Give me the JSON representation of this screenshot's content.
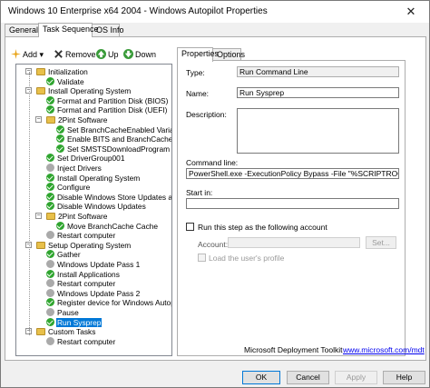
{
  "window": {
    "title": "Windows 10 Enterprise x64 2004 - Windows Autopilot Properties",
    "close": "✕"
  },
  "tabs": [
    {
      "label": "General"
    },
    {
      "label": "Task Sequence"
    },
    {
      "label": "OS Info"
    }
  ],
  "toolbar": {
    "add": "Add",
    "remove": "Remove",
    "up": "Up",
    "down": "Down",
    "chevron": "▾"
  },
  "tree": [
    {
      "label": "Initialization",
      "icon": "folder-icon"
    },
    {
      "label": "Validate",
      "icon": "check-icon"
    },
    {
      "label": "Install Operating System",
      "icon": "folder-icon"
    },
    {
      "label": "Format and Partition Disk (BIOS)",
      "icon": "check-icon"
    },
    {
      "label": "Format and Partition Disk (UEFI)",
      "icon": "check-icon"
    },
    {
      "label": "2Pint Software",
      "icon": "folder-icon"
    },
    {
      "label": "Set BranchCacheEnabled Variable",
      "icon": "check-icon"
    },
    {
      "label": "Enable BITS and BranchCache",
      "icon": "check-icon"
    },
    {
      "label": "Set SMSTSDownloadProgram Variab",
      "icon": "check-icon"
    },
    {
      "label": "Set DriverGroup001",
      "icon": "check-icon"
    },
    {
      "label": "Inject Drivers",
      "icon": "gray-icon"
    },
    {
      "label": "Install Operating System",
      "icon": "check-icon"
    },
    {
      "label": "Configure",
      "icon": "check-icon"
    },
    {
      "label": "Disable Windows Store Updates and Con",
      "icon": "check-icon"
    },
    {
      "label": "Disable Windows Updates",
      "icon": "check-icon"
    },
    {
      "label": "2Pint Software",
      "icon": "folder-icon"
    },
    {
      "label": "Move BranchCache Cache",
      "icon": "check-icon"
    },
    {
      "label": "Restart computer",
      "icon": "gray-icon"
    },
    {
      "label": "Setup Operating System",
      "icon": "folder-icon"
    },
    {
      "label": "Gather",
      "icon": "check-icon"
    },
    {
      "label": "Windows Update Pass 1",
      "icon": "gray-icon"
    },
    {
      "label": "Install Applications",
      "icon": "check-icon"
    },
    {
      "label": "Restart computer",
      "icon": "gray-icon"
    },
    {
      "label": "Windows Update Pass 2",
      "icon": "gray-icon"
    },
    {
      "label": "Register device for Windows Autopilot (Pr",
      "icon": "check-icon"
    },
    {
      "label": "Pause",
      "icon": "gray-icon"
    },
    {
      "label": "Run Sysprep",
      "icon": "check-icon"
    },
    {
      "label": "Custom Tasks",
      "icon": "folder-icon"
    },
    {
      "label": "Restart computer",
      "icon": "gray-icon"
    }
  ],
  "right_tabs": [
    {
      "label": "Properties"
    },
    {
      "label": "Options"
    }
  ],
  "props": {
    "type_label": "Type:",
    "type_value": "Run Command Line",
    "name_label": "Name:",
    "name_value": "Run Sysprep",
    "desc_label": "Description:",
    "cmd_label": "Command line:",
    "cmd_value": "PowerShell.exe -ExecutionPolicy Bypass -File \"%SCRIPTROOT%\\PSDAutop",
    "startin_label": "Start in:",
    "runas_label": "Run this step as the following account",
    "account_label": "Account:",
    "set_button": "Set...",
    "load_profile_label": "Load the user's profile"
  },
  "footer": {
    "brand": "Microsoft Deployment Toolkit",
    "link": "www.microsoft.com/mdt"
  },
  "buttons": {
    "ok": "OK",
    "cancel": "Cancel",
    "apply": "Apply",
    "help": "Help"
  },
  "colors": {
    "accent": "#0078d7",
    "check": "#2fa52f",
    "folder": "#e8c04a"
  }
}
